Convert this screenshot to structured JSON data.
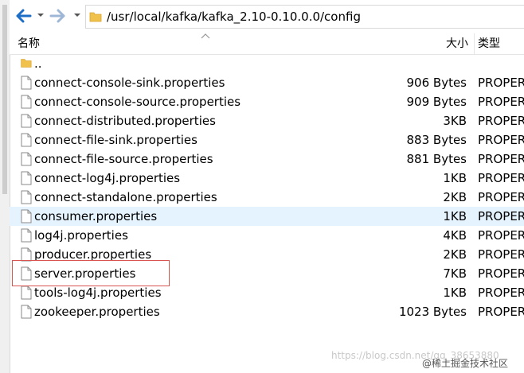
{
  "address_bar": {
    "path": "/usr/local/kafka/kafka_2.10-0.10.0.0/config"
  },
  "columns": {
    "name": "名称",
    "size": "大小",
    "type": "类型"
  },
  "parent_row": {
    "name": ".."
  },
  "files": [
    {
      "name": "connect-console-sink.properties",
      "size": "906 Bytes",
      "type": "PROPER"
    },
    {
      "name": "connect-console-source.properties",
      "size": "909 Bytes",
      "type": "PROPER"
    },
    {
      "name": "connect-distributed.properties",
      "size": "3KB",
      "type": "PROPER"
    },
    {
      "name": "connect-file-sink.properties",
      "size": "883 Bytes",
      "type": "PROPER"
    },
    {
      "name": "connect-file-source.properties",
      "size": "881 Bytes",
      "type": "PROPER"
    },
    {
      "name": "connect-log4j.properties",
      "size": "1KB",
      "type": "PROPER"
    },
    {
      "name": "connect-standalone.properties",
      "size": "2KB",
      "type": "PROPER"
    },
    {
      "name": "consumer.properties",
      "size": "1KB",
      "type": "PROPER"
    },
    {
      "name": "log4j.properties",
      "size": "4KB",
      "type": "PROPER"
    },
    {
      "name": "producer.properties",
      "size": "2KB",
      "type": "PROPER"
    },
    {
      "name": "server.properties",
      "size": "7KB",
      "type": "PROPER"
    },
    {
      "name": "tools-log4j.properties",
      "size": "1KB",
      "type": "PROPER"
    },
    {
      "name": "zookeeper.properties",
      "size": "1023 Bytes",
      "type": "PROPER"
    }
  ],
  "watermark": {
    "url_text": "https://blog.csdn.net/qq_38653880",
    "site_text": "@稀土掘金技术社区"
  },
  "colors": {
    "selected_row": "#e5f3ff",
    "highlight_border": "#d9534f",
    "folder": "#f0c24b"
  },
  "icons": {
    "back": "arrow-left-icon",
    "forward": "arrow-right-icon",
    "folder": "folder-icon",
    "file": "file-icon"
  }
}
